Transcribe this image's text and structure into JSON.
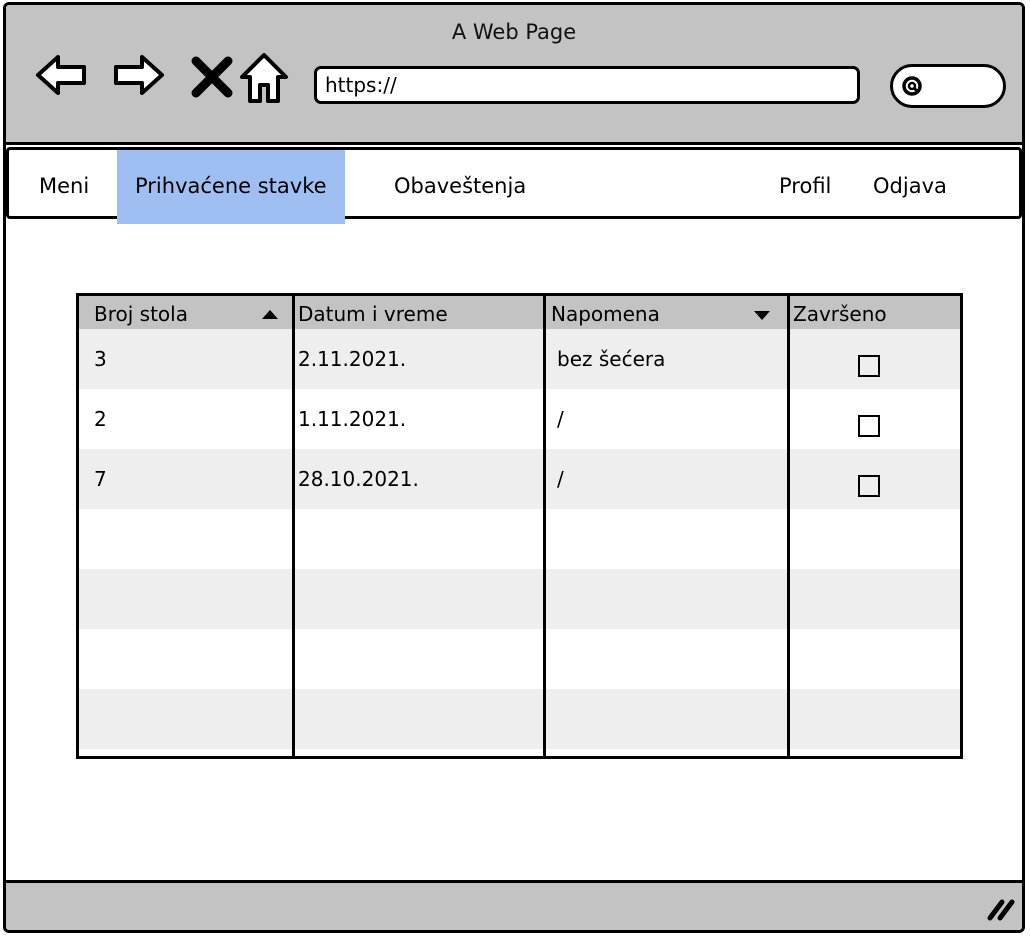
{
  "window": {
    "title": "A Web Page",
    "url": "https://"
  },
  "navbar": {
    "items": [
      {
        "label": "Meni"
      },
      {
        "label": "Prihvaćene stavke",
        "active": true
      },
      {
        "label": "Obaveštenja"
      },
      {
        "label": "Profil"
      },
      {
        "label": "Odjava"
      }
    ]
  },
  "table": {
    "columns": [
      {
        "label": "Broj stola",
        "sort": "ascending"
      },
      {
        "label": "Datum i vreme"
      },
      {
        "label": "Napomena",
        "sort": "descending"
      },
      {
        "label": "Završeno"
      }
    ],
    "rows": [
      {
        "broj_stola": "3",
        "datum": "2.11.2021.",
        "napomena": "bez šećera",
        "zavrseno": false
      },
      {
        "broj_stola": "2",
        "datum": "1.11.2021.",
        "napomena": "/",
        "zavrseno": false
      },
      {
        "broj_stola": "7",
        "datum": "28.10.2021.",
        "napomena": "/",
        "zavrseno": false
      }
    ]
  },
  "colors": {
    "chrome": "#c3c3c3",
    "active_tab": "#9fbff2",
    "row_alt": "#eeeeee"
  }
}
